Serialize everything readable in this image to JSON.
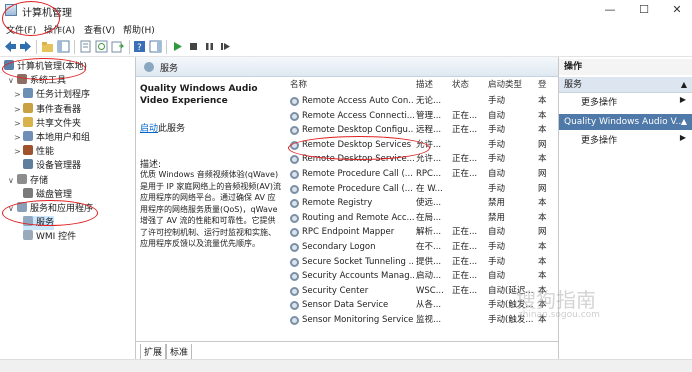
{
  "window": {
    "title": "计算机管理",
    "min": "—",
    "max": "☐",
    "close": "✕"
  },
  "menu": [
    "文件(F)",
    "操作(A)",
    "查看(V)",
    "帮助(H)"
  ],
  "tree": [
    {
      "label": "计算机管理(本地)",
      "level": 0,
      "exp": "",
      "color": "#5b7fa6"
    },
    {
      "label": "系统工具",
      "level": 1,
      "exp": "∨",
      "color": "#8d6e63"
    },
    {
      "label": "任务计划程序",
      "level": 2,
      "exp": ">",
      "color": "#6d8fb3"
    },
    {
      "label": "事件查看器",
      "level": 2,
      "exp": ">",
      "color": "#c9a042"
    },
    {
      "label": "共享文件夹",
      "level": 2,
      "exp": ">",
      "color": "#d8b24a"
    },
    {
      "label": "本地用户和组",
      "level": 2,
      "exp": ">",
      "color": "#6f8fb6"
    },
    {
      "label": "性能",
      "level": 2,
      "exp": ">",
      "color": "#a0522d"
    },
    {
      "label": "设备管理器",
      "level": 2,
      "exp": "",
      "color": "#5f7f9f"
    },
    {
      "label": "存储",
      "level": 1,
      "exp": "∨",
      "color": "#8d8d8d"
    },
    {
      "label": "磁盘管理",
      "level": 2,
      "exp": "",
      "color": "#7a7a7a"
    },
    {
      "label": "服务和应用程序",
      "level": 1,
      "exp": "∨",
      "color": "#8aa0b8"
    },
    {
      "label": "服务",
      "level": 2,
      "exp": "",
      "color": "#8fa7c0",
      "selected": true
    },
    {
      "label": "WMI 控件",
      "level": 2,
      "exp": "",
      "color": "#9aaabb"
    }
  ],
  "middle": {
    "header": "服务",
    "service_title": "Quality Windows Audio Video Experience",
    "start_link": "启动",
    "start_suffix": "此服务",
    "desc_label": "描述:",
    "description": "优质 Windows 音频视频体验(qWave)是用于 IP 家庭网络上的音频视频(AV)流应用程序的网络平台。通过确保 AV 应用程序的网络服务质量(QoS)，qWave 增强了 AV 流的性能和可靠性。它提供了许可控制机制、运行时监视和实施、应用程序反馈以及流量优先顺序。",
    "columns": {
      "name": "名称",
      "desc": "描述",
      "status": "状态",
      "startup": "启动类型",
      "logon": "登"
    },
    "rows": [
      {
        "name": "Remote Access Auto Con...",
        "desc": "无论...",
        "status": "",
        "startup": "手动",
        "logon": "本"
      },
      {
        "name": "Remote Access Connecti...",
        "desc": "管理...",
        "status": "正在...",
        "startup": "自动",
        "logon": "本"
      },
      {
        "name": "Remote Desktop Configu...",
        "desc": "远程...",
        "status": "正在...",
        "startup": "手动",
        "logon": "本"
      },
      {
        "name": "Remote Desktop Services",
        "desc": "允许...",
        "status": "",
        "startup": "手动",
        "logon": "网"
      },
      {
        "name": "Remote Desktop Service...",
        "desc": "允许...",
        "status": "正在...",
        "startup": "手动",
        "logon": "本"
      },
      {
        "name": "Remote Procedure Call (...",
        "desc": "RPC...",
        "status": "正在...",
        "startup": "自动",
        "logon": "网"
      },
      {
        "name": "Remote Procedure Call (...",
        "desc": "在 W...",
        "status": "",
        "startup": "手动",
        "logon": "网"
      },
      {
        "name": "Remote Registry",
        "desc": "使远...",
        "status": "",
        "startup": "禁用",
        "logon": "本"
      },
      {
        "name": "Routing and Remote Acc...",
        "desc": "在局...",
        "status": "",
        "startup": "禁用",
        "logon": "本"
      },
      {
        "name": "RPC Endpoint Mapper",
        "desc": "解析...",
        "status": "正在...",
        "startup": "自动",
        "logon": "网"
      },
      {
        "name": "Secondary Logon",
        "desc": "在不...",
        "status": "正在...",
        "startup": "手动",
        "logon": "本"
      },
      {
        "name": "Secure Socket Tunneling ...",
        "desc": "提供...",
        "status": "正在...",
        "startup": "手动",
        "logon": "本"
      },
      {
        "name": "Security Accounts Manag...",
        "desc": "启动...",
        "status": "正在...",
        "startup": "自动",
        "logon": "本"
      },
      {
        "name": "Security Center",
        "desc": "WSC...",
        "status": "正在...",
        "startup": "自动(延迟...",
        "logon": "本"
      },
      {
        "name": "Sensor Data Service",
        "desc": "从各...",
        "status": "",
        "startup": "手动(触发...",
        "logon": "本"
      },
      {
        "name": "Sensor Monitoring Service",
        "desc": "监视...",
        "status": "",
        "startup": "手动(触发...",
        "logon": "本"
      }
    ],
    "tabs": [
      "扩展",
      "标准"
    ]
  },
  "actions": {
    "header": "操作",
    "group1": "服务",
    "item1": "更多操作",
    "group2": "Quality Windows Audio V...",
    "item2": "更多操作"
  },
  "watermark": {
    "main": "搜狗指南",
    "sub": "zhinan.sogou.com"
  }
}
